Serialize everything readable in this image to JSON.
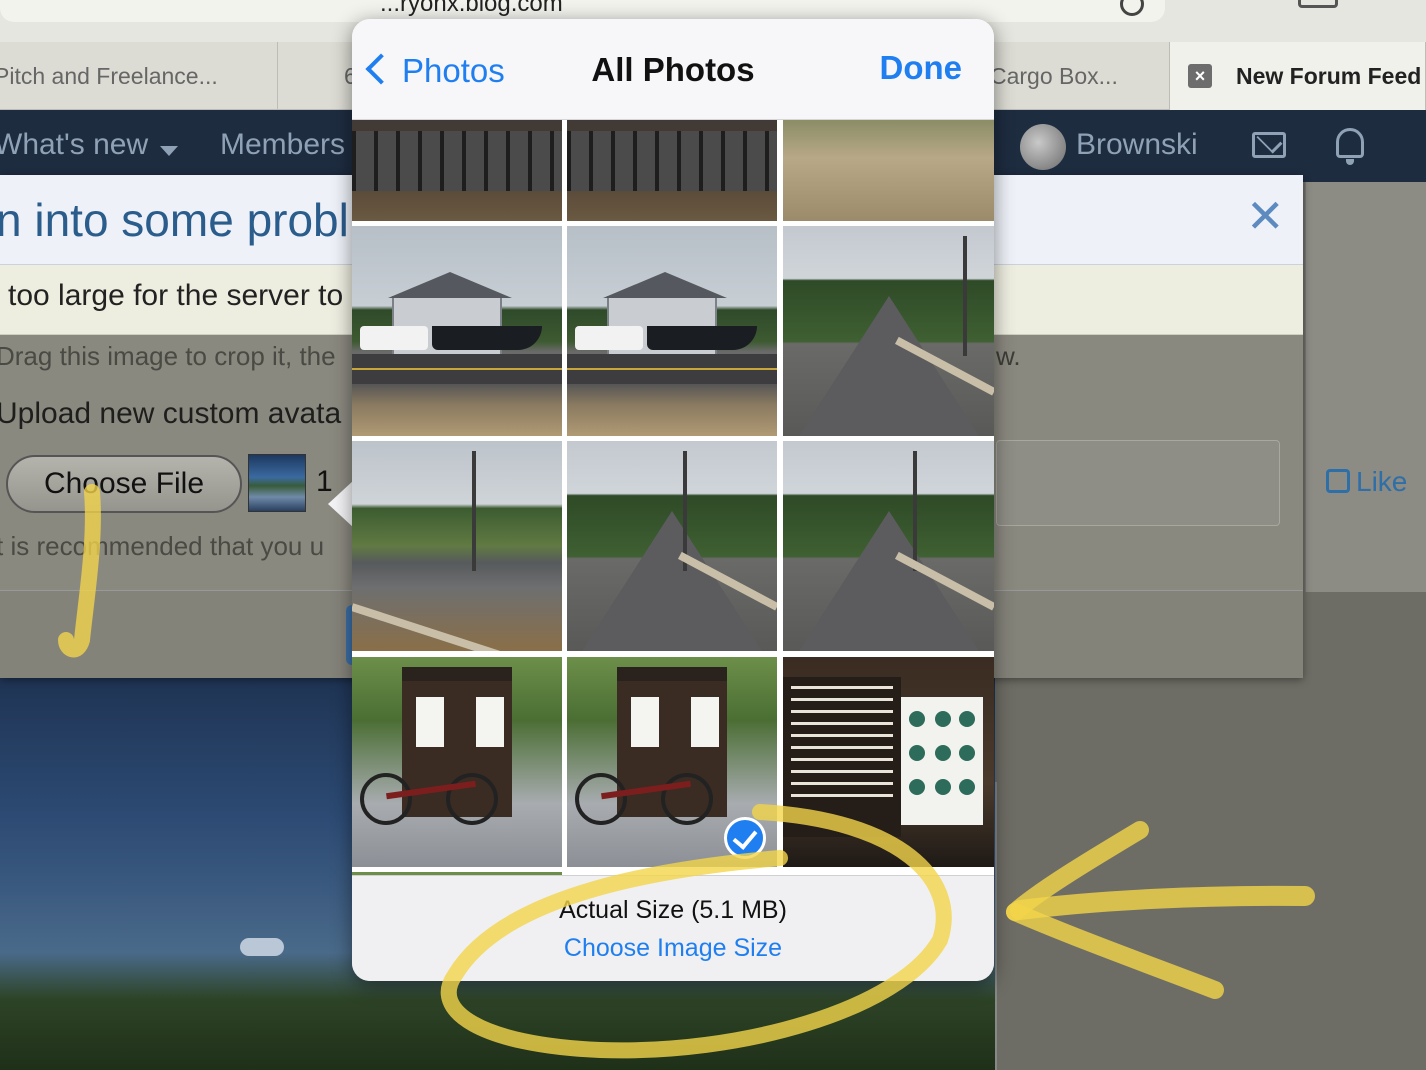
{
  "browser": {
    "url_fragment": "...ryonx.blog.com",
    "tabs": [
      {
        "label": "Pitch and Freelance..."
      },
      {
        "label": "6"
      },
      {
        "label": "Cargo Box..."
      },
      {
        "label": "New Forum Feed",
        "close_icon": "close-icon"
      }
    ]
  },
  "site_nav": {
    "whats_new": "What's new",
    "members": "Members",
    "username": "Brownski",
    "icons": [
      "chevron-down-icon",
      "avatar",
      "mail-icon",
      "bell-icon"
    ]
  },
  "error_dialog": {
    "title": "n into some probl",
    "message": "too large for the server to",
    "hint": "Drag this image to crop it, the",
    "hint_tail": "w.",
    "upload_label": "Upload new custom avata",
    "choose_file": "Choose File",
    "file_count": "1",
    "recommend": "t is recommended that you u",
    "close_icon": "close-icon"
  },
  "like_label": "Like",
  "picker": {
    "back_label": "Photos",
    "title": "All Photos",
    "done_label": "Done",
    "selected_index": 10,
    "footer": {
      "size_label": "Actual Size (5.1 MB)",
      "choose_size": "Choose Image Size"
    }
  },
  "colors": {
    "ios_blue": "#1f7ff0",
    "annotation_yellow": "#f3d54a",
    "forum_nav": "#1e2c40"
  }
}
